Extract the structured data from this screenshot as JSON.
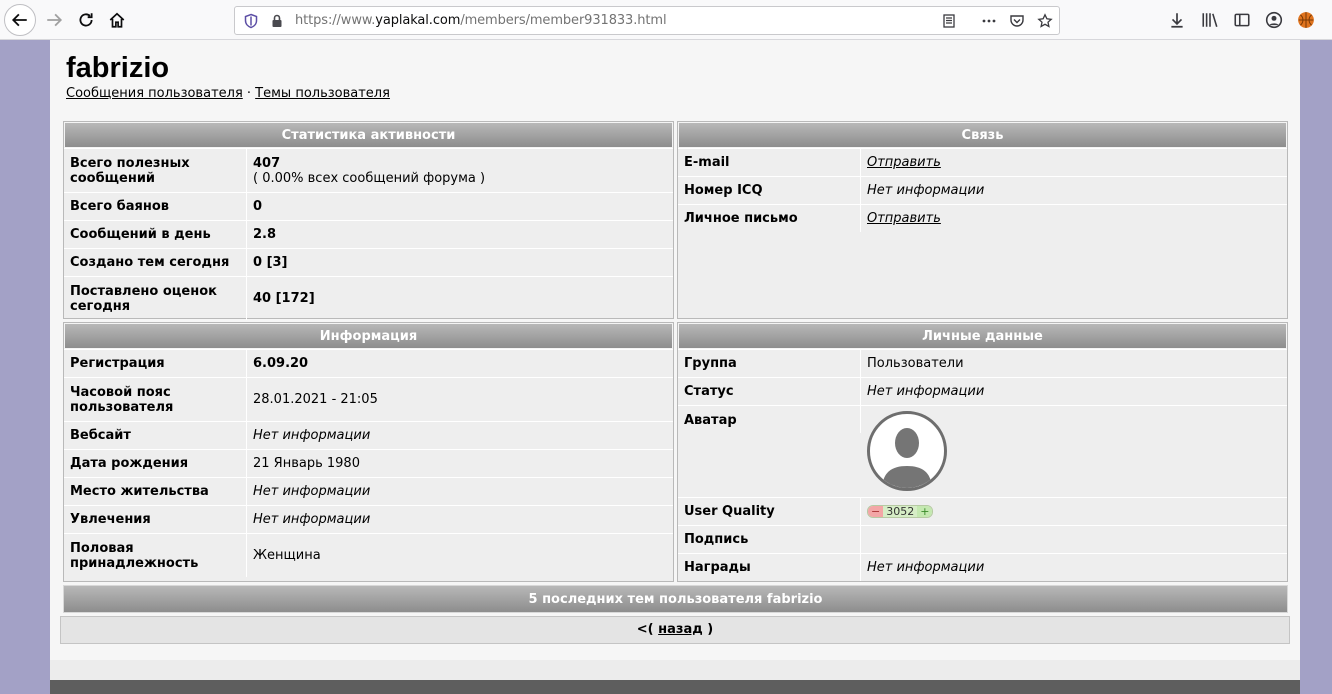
{
  "browser": {
    "url_prefix": "https://www.",
    "url_host": "yaplakal.com",
    "url_path": "/members/member931833.html"
  },
  "profile": {
    "username": "fabrizio",
    "links": [
      "Сообщения пользователя",
      "Темы пользователя"
    ],
    "separator": " · "
  },
  "activity": {
    "title": "Статистика активности",
    "rows": [
      {
        "label": "Всего полезных сообщений",
        "value": "407",
        "sub": "( 0.00% всех сообщений форума )"
      },
      {
        "label": "Всего баянов",
        "value": "0"
      },
      {
        "label": "Сообщений в день",
        "value": "2.8"
      },
      {
        "label": "Создано тем сегодня",
        "value": "0 [3]"
      },
      {
        "label": "Поставлено оценок сегодня",
        "value": "40 [172]"
      }
    ]
  },
  "contact": {
    "title": "Связь",
    "rows": [
      {
        "label": "E-mail",
        "value": "Отправить"
      },
      {
        "label": "Номер ICQ",
        "value": "Нет информации"
      },
      {
        "label": "Личное письмо",
        "value": "Отправить"
      }
    ]
  },
  "info": {
    "title": "Информация",
    "rows": [
      {
        "label": "Регистрация",
        "value": "6.09.20"
      },
      {
        "label": "Часовой пояс пользователя",
        "value": "28.01.2021 - 21:05"
      },
      {
        "label": "Вебсайт",
        "value": "Нет информации"
      },
      {
        "label": "Дата рождения",
        "value": "21 Январь 1980"
      },
      {
        "label": "Место жительства",
        "value": "Нет информации"
      },
      {
        "label": "Увлечения",
        "value": "Нет информации"
      },
      {
        "label": "Половая принадлежность",
        "value": "Женщина"
      }
    ]
  },
  "personal": {
    "title": "Личные данные",
    "rows": [
      {
        "label": "Группа",
        "value": "Пользователи"
      },
      {
        "label": "Статус",
        "value": "Нет информации"
      },
      {
        "label": "Аватар",
        "value": ""
      },
      {
        "label": "User Quality",
        "value": "3052",
        "minus": "−",
        "plus": "+"
      },
      {
        "label": "Подпись",
        "value": ""
      },
      {
        "label": "Награды",
        "value": "Нет информации"
      }
    ]
  },
  "recent_topics": {
    "title": "5 последних тем пользователя fabrizio"
  },
  "back": {
    "prefix": "<(",
    "link": "назад",
    "suffix": ")"
  },
  "colors": {
    "page_bg": "#a3a1c6",
    "panel_head": "#9a9a9a"
  }
}
